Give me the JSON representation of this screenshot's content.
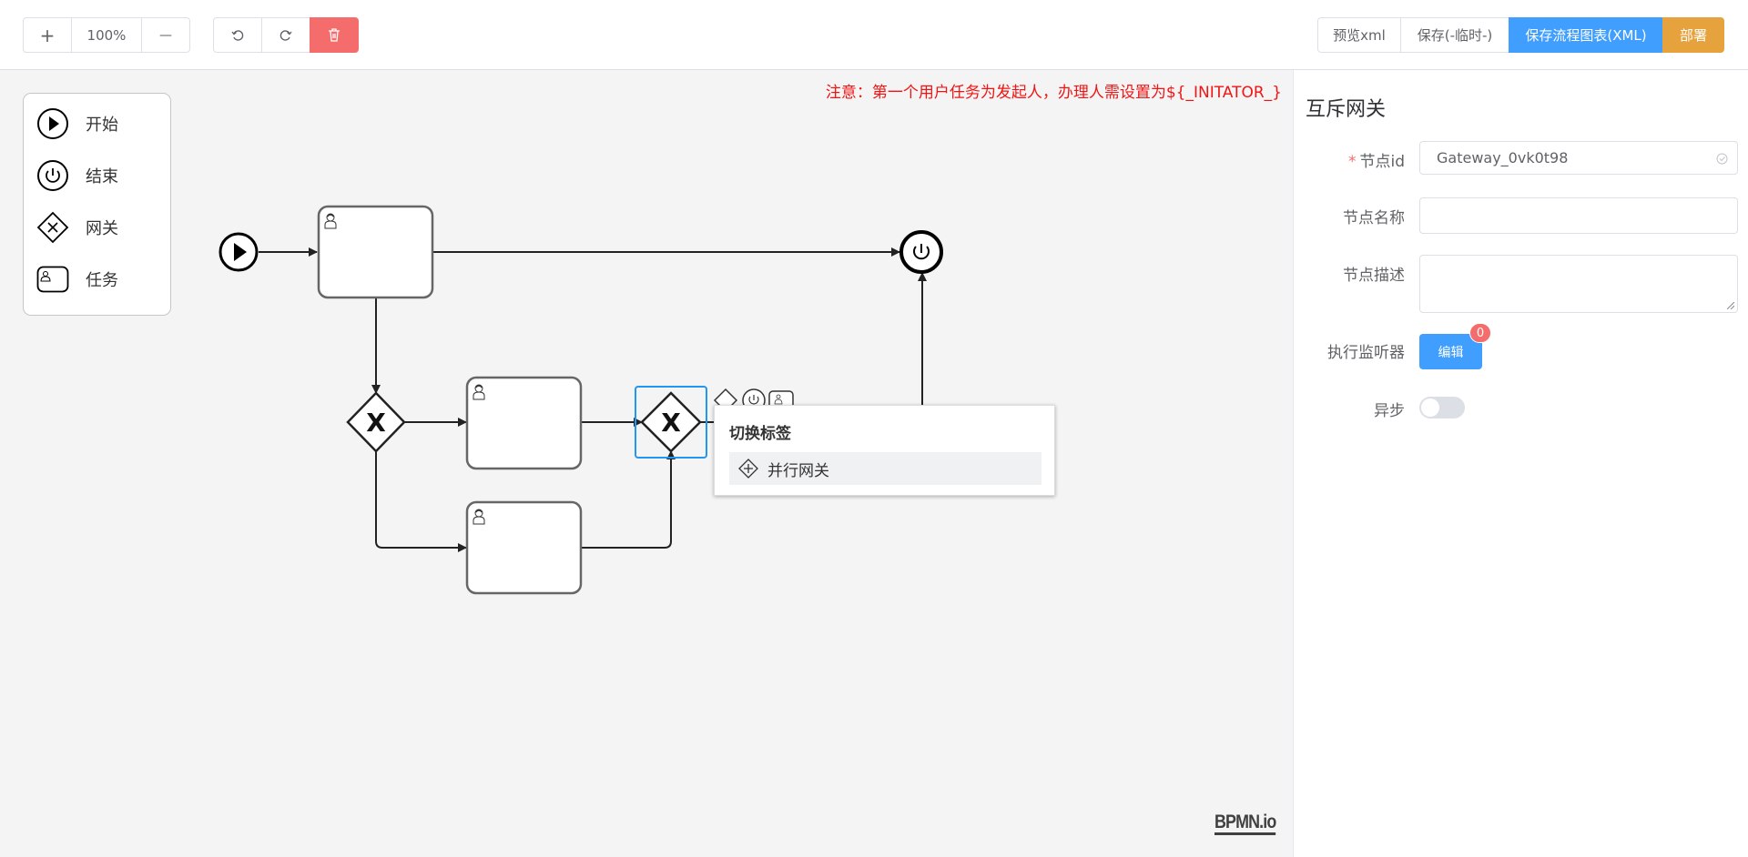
{
  "toolbar": {
    "zoom_in_label": "+",
    "zoom_level": "100%",
    "zoom_out_label": "—",
    "undo_icon": "undo-icon",
    "redo_icon": "redo-icon",
    "delete_icon": "trash-icon",
    "preview_xml_label": "预览xml",
    "save_temp_label": "保存(-临时-)",
    "save_xml_label": "保存流程图表(XML)",
    "deploy_label": "部署"
  },
  "canvas": {
    "notice": "注意：第一个用户任务为发起人，办理人需设置为${_INITATOR_}",
    "watermark": "BPMN.io"
  },
  "palette": {
    "items": [
      {
        "label": "开始",
        "icon": "start-event-icon"
      },
      {
        "label": "结束",
        "icon": "end-event-icon"
      },
      {
        "label": "网关",
        "icon": "gateway-icon"
      },
      {
        "label": "任务",
        "icon": "user-task-icon"
      }
    ]
  },
  "popup": {
    "title": "切换标签",
    "items": [
      {
        "label": "并行网关",
        "icon": "parallel-gateway-icon"
      }
    ]
  },
  "panel": {
    "title": "互斥网关",
    "node_id_label": "节点id",
    "node_id_value": "Gateway_0vk0t98",
    "node_name_label": "节点名称",
    "node_name_value": "",
    "node_desc_label": "节点描述",
    "node_desc_value": "",
    "listener_label": "执行监听器",
    "listener_button": "编辑",
    "listener_count": "0",
    "async_label": "异步",
    "async_value": false
  },
  "colors": {
    "primary": "#409eff",
    "danger": "#f56c6c",
    "warning": "#e6a23c",
    "notice": "#f01515",
    "selection": "#2196f3"
  }
}
